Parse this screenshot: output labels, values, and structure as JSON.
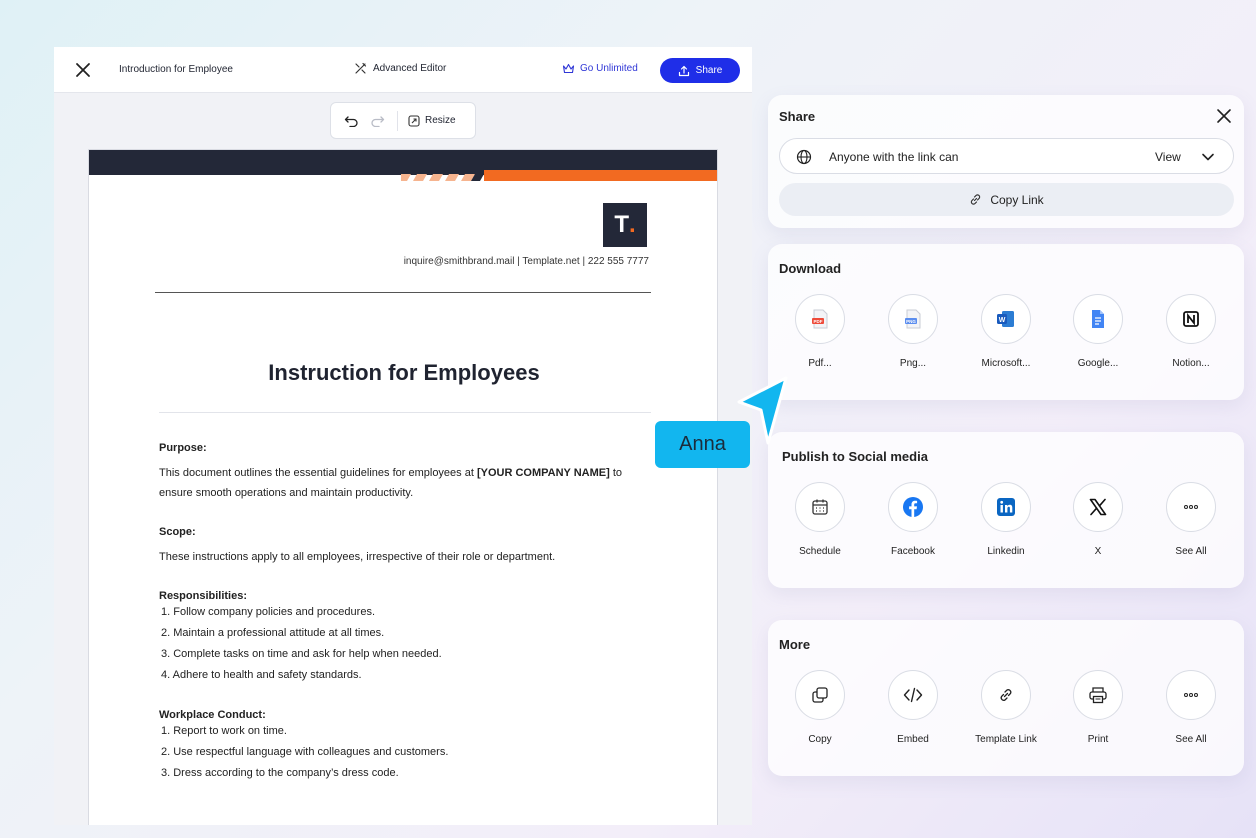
{
  "editor": {
    "doc_title": "Introduction for Employee",
    "advanced_editor": "Advanced Editor",
    "go_unlimited": "Go Unlimited",
    "share": "Share",
    "resize": "Resize"
  },
  "document": {
    "logo_letter": "T",
    "logo_dot": ".",
    "contact": "inquire@smithbrand.mail  |  Template.net  |  222 555 7777",
    "heading": "Instruction for Employees",
    "purpose_title": "Purpose:",
    "purpose_pre": "This document outlines the essential guidelines for employees at ",
    "purpose_bold": "[YOUR COMPANY NAME]",
    "purpose_post": " to ensure smooth operations and maintain productivity.",
    "scope_title": "Scope:",
    "scope_text": "These instructions apply to all employees, irrespective of their role or department.",
    "resp_title": "Responsibilities:",
    "resp_items": [
      "1. Follow company policies and procedures.",
      "2. Maintain a professional attitude at all times.",
      "3. Complete tasks on time and ask for help when needed.",
      "4. Adhere to health and safety standards."
    ],
    "conduct_title": "Workplace Conduct:",
    "conduct_items": [
      "1. Report to work on time.",
      "2. Use respectful language with colleagues and customers.",
      "3. Dress according to the company’s dress code."
    ]
  },
  "share_panel": {
    "title": "Share",
    "link_access": "Anyone with the link can",
    "permission": "View",
    "copy_link": "Copy Link"
  },
  "download": {
    "title": "Download",
    "items": [
      {
        "label": "Pdf...",
        "icon": "pdf-file-icon"
      },
      {
        "label": "Png...",
        "icon": "png-file-icon"
      },
      {
        "label": "Microsoft...",
        "icon": "microsoft-word-icon"
      },
      {
        "label": "Google...",
        "icon": "google-docs-icon"
      },
      {
        "label": "Notion...",
        "icon": "notion-icon"
      }
    ]
  },
  "social": {
    "title": "Publish to Social media",
    "items": [
      {
        "label": "Schedule",
        "icon": "calendar-icon"
      },
      {
        "label": "Facebook",
        "icon": "facebook-icon"
      },
      {
        "label": "Linkedin",
        "icon": "linkedin-icon"
      },
      {
        "label": "X",
        "icon": "x-icon"
      },
      {
        "label": "See All",
        "icon": "more-dots-icon"
      }
    ]
  },
  "more": {
    "title": "More",
    "items": [
      {
        "label": "Copy",
        "icon": "copy-icon"
      },
      {
        "label": "Embed",
        "icon": "code-icon"
      },
      {
        "label": "Template Link",
        "icon": "link-icon"
      },
      {
        "label": "Print",
        "icon": "printer-icon"
      },
      {
        "label": "See All",
        "icon": "more-dots-icon"
      }
    ]
  },
  "collaborator": {
    "name": "Anna",
    "color": "#12b6ef"
  },
  "colors": {
    "primary": "#1f2ee8",
    "accent": "#f26a21",
    "dark": "#232838"
  }
}
